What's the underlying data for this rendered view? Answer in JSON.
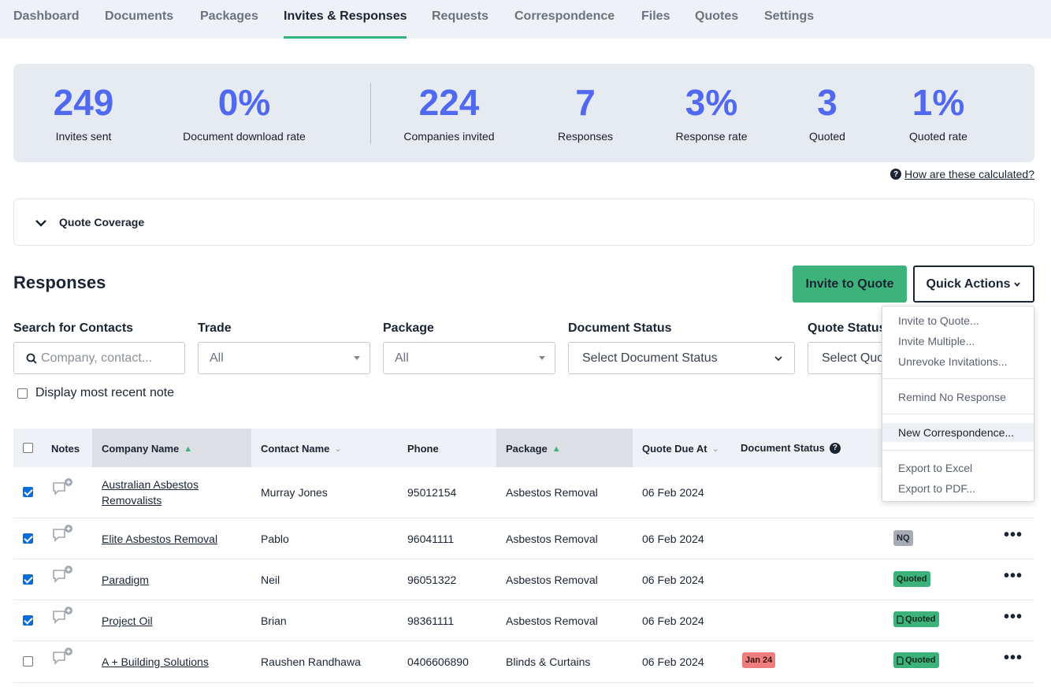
{
  "nav": {
    "tabs": [
      "Dashboard",
      "Documents",
      "Packages",
      "Invites & Responses",
      "Requests",
      "Correspondence",
      "Files",
      "Quotes",
      "Settings"
    ],
    "active": "Invites & Responses"
  },
  "stats": [
    {
      "value": "249",
      "label": "Invites sent"
    },
    {
      "value": "0%",
      "label": "Document download rate"
    },
    {
      "value": "224",
      "label": "Companies invited"
    },
    {
      "value": "7",
      "label": "Responses"
    },
    {
      "value": "3%",
      "label": "Response rate"
    },
    {
      "value": "3",
      "label": "Quoted"
    },
    {
      "value": "1%",
      "label": "Quoted rate"
    }
  ],
  "help_link": "How are these calculated?",
  "coverage_title": "Quote Coverage",
  "section_title": "Responses",
  "buttons": {
    "invite": "Invite to Quote",
    "quick_actions": "Quick Actions"
  },
  "filters": {
    "search_label": "Search for Contacts",
    "search_placeholder": "Company, contact...",
    "trade_label": "Trade",
    "trade_value": "All",
    "package_label": "Package",
    "package_value": "All",
    "doc_status_label": "Document Status",
    "doc_status_value": "Select Document Status",
    "quote_status_label": "Quote Status",
    "quote_status_value": "Select Quo",
    "recent_note_label": "Display most recent note"
  },
  "table": {
    "headers": {
      "notes": "Notes",
      "company": "Company Name",
      "contact": "Contact Name",
      "phone": "Phone",
      "package": "Package",
      "due": "Quote Due At",
      "doc_status": "Document Status"
    },
    "rows": [
      {
        "checked": true,
        "company_line1": "Australian Asbestos",
        "company_line2": "Removalists",
        "contact": "Murray Jones",
        "phone": "95012154",
        "package": "Asbestos Removal",
        "due": "06 Feb 2024",
        "doc_badge": "",
        "quote_badge": "",
        "quote_badge_type": ""
      },
      {
        "checked": true,
        "company_line1": "Elite Asbestos Removal",
        "company_line2": "",
        "contact": "Pablo",
        "phone": "96041111",
        "package": "Asbestos Removal",
        "due": "06 Feb 2024",
        "doc_badge": "",
        "quote_badge": "NQ",
        "quote_badge_type": "nq"
      },
      {
        "checked": true,
        "company_line1": "Paradigm",
        "company_line2": "",
        "contact": "Neil",
        "phone": "96051322",
        "package": "Asbestos Removal",
        "due": "06 Feb 2024",
        "doc_badge": "",
        "quote_badge": "Quoted",
        "quote_badge_type": "quoted"
      },
      {
        "checked": true,
        "company_line1": "Project Oil",
        "company_line2": "",
        "contact": "Brian",
        "phone": "98361111",
        "package": "Asbestos Removal",
        "due": "06 Feb 2024",
        "doc_badge": "",
        "quote_badge": "Quoted",
        "quote_badge_type": "quoted-doc"
      },
      {
        "checked": false,
        "company_line1": "A + Building Solutions",
        "company_line2": "",
        "contact": "Raushen Randhawa",
        "phone": "0406606890",
        "package": "Blinds & Curtains",
        "due": "06 Feb 2024",
        "doc_badge": "Jan 24",
        "quote_badge": "Quoted",
        "quote_badge_type": "quoted-doc"
      }
    ]
  },
  "quick_actions_menu": {
    "group1": [
      "Invite to Quote...",
      "Invite Multiple...",
      "Unrevoke Invitations..."
    ],
    "group2": [
      "Remind No Response"
    ],
    "group3": [
      "New Correspondence..."
    ],
    "group4": [
      "Export to Excel",
      "Export to PDF..."
    ],
    "highlighted": "New Correspondence..."
  },
  "colors": {
    "accent_green": "#3db27a",
    "stat_blue": "#5168f0",
    "badge_red": "#ee7d7d",
    "badge_gray": "#a7acb4"
  }
}
